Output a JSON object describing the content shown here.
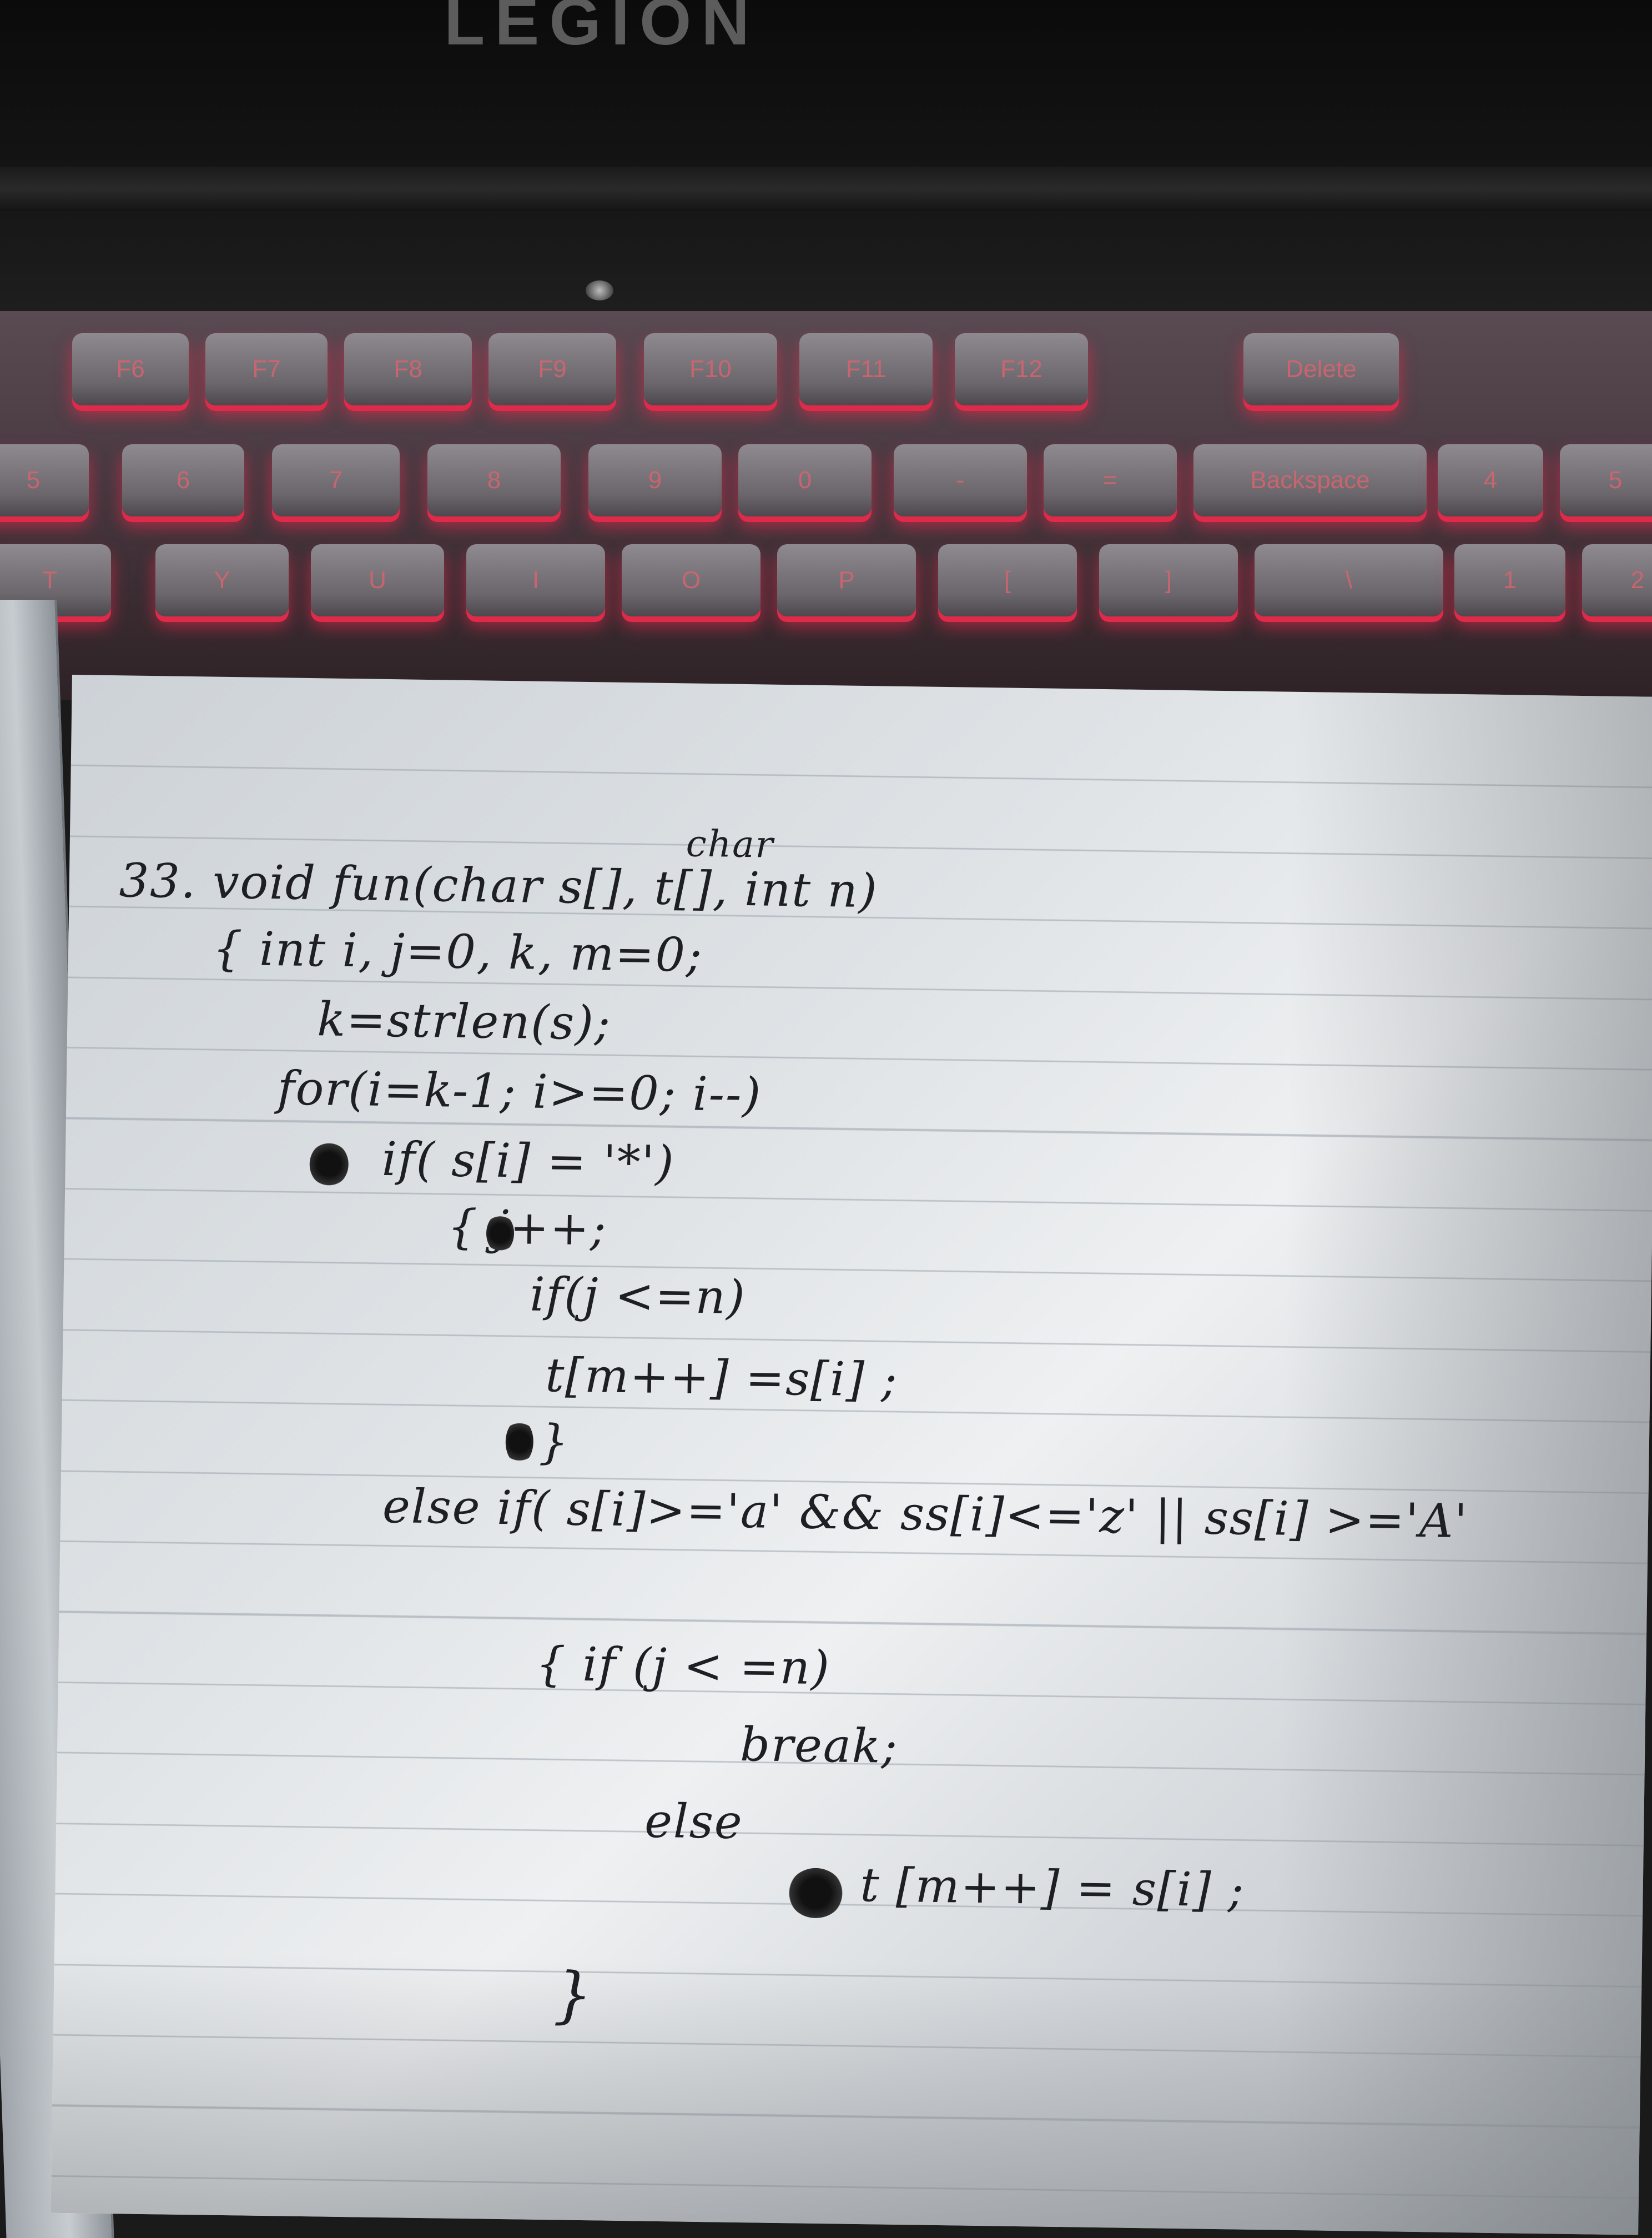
{
  "laptop": {
    "logo": "LEGION",
    "keys_row_function": [
      "F6",
      "F7",
      "F8",
      "F9",
      "F10",
      "F11",
      "F12",
      "Delete"
    ],
    "keys_row_number": [
      "5",
      "6",
      "7",
      "8",
      "9",
      "0",
      "-",
      "=",
      "Backspace",
      "4",
      "5"
    ],
    "keys_row_letters": [
      "T",
      "Y",
      "U",
      "I",
      "O",
      "P",
      "[",
      "]",
      "\\",
      "1",
      "2"
    ]
  },
  "colors": {
    "keyboard_backlight": "#e02a4a",
    "page": "#e3e6e9",
    "ink": "#1e1f24"
  },
  "handwriting": {
    "lines": [
      "33. void fun(char s[], t[], int n)",
      "{ int i, j=0, k, m=0;",
      "k=strlen(s);",
      "for(i=k-1; i>=0; i--)",
      "if( s[i] = '*')",
      "{ j++;",
      "if(j <=n)",
      "t[m++] =s[i] ;",
      "}",
      "else if( s[i]>='a' && ss[i]<='z' || ss[i] >='A'",
      "{ if (j < =n)",
      "break;",
      "else",
      "t [m++] = s[i] ;",
      "}"
    ],
    "annotation_above": "char"
  }
}
